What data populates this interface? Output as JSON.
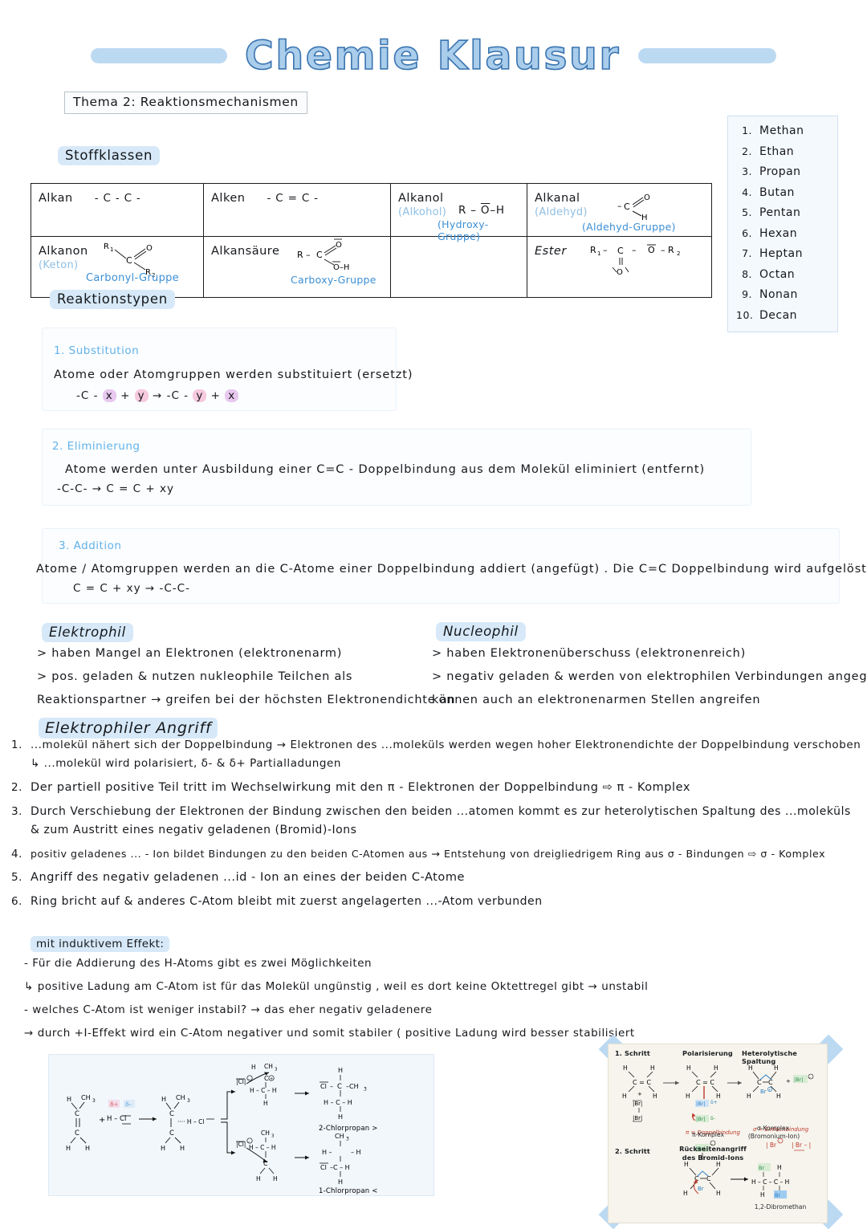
{
  "header": {
    "title": "Chemie Klausur",
    "topic": "Thema 2: Reaktionsmechanismen"
  },
  "sections": {
    "stoffklassen": "Stoffklassen",
    "reaktionstypen": "Reaktionstypen",
    "elektrophil": "Elektrophil",
    "nucleophil": "Nucleophil",
    "elektrophiler_angriff": "Elektrophiler Angriff",
    "induktiver_effekt": "mit induktivem Effekt:"
  },
  "stoffklassen_table": {
    "rows": [
      [
        {
          "name": "Alkan",
          "sub": "",
          "formula": "- C - C -",
          "group": ""
        },
        {
          "name": "Alken",
          "sub": "",
          "formula": "- C = C -",
          "group": ""
        },
        {
          "name": "Alkanol",
          "sub": "(Alkohol)",
          "formula": "R - O - H",
          "group": "(Hydroxy-Gruppe)"
        },
        {
          "name": "Alkanal",
          "sub": "(Aldehyd)",
          "formula": "- C O H",
          "group": "(Aldehyd-Gruppe)"
        }
      ],
      [
        {
          "name": "Alkanon",
          "sub": "(Keton)",
          "formula": "R1 C O R2",
          "group": "Carbonyl-Gruppe"
        },
        {
          "name": "Alkansäure",
          "sub": "",
          "formula": "R - C O O-H",
          "group": "Carboxy-Gruppe"
        },
        {
          "name": "",
          "sub": "",
          "formula": "",
          "group": ""
        },
        {
          "name": "Ester",
          "sub": "",
          "formula": "R1 - C - O - R2",
          "group": ""
        }
      ]
    ]
  },
  "alkane_list": {
    "items": [
      {
        "num": "1.",
        "name": "Methan"
      },
      {
        "num": "2.",
        "name": "Ethan"
      },
      {
        "num": "3.",
        "name": "Propan"
      },
      {
        "num": "4.",
        "name": "Butan"
      },
      {
        "num": "5.",
        "name": "Pentan"
      },
      {
        "num": "6.",
        "name": "Hexan"
      },
      {
        "num": "7.",
        "name": "Heptan"
      },
      {
        "num": "8.",
        "name": "Octan"
      },
      {
        "num": "9.",
        "name": "Nonan"
      },
      {
        "num": "10.",
        "name": "Decan"
      }
    ]
  },
  "reaktionstypen": {
    "substitution": {
      "label": "1. Substitution",
      "text": "Atome   oder   Atomgruppen   werden   substituiert  (ersetzt)",
      "eqn_pre": "-C -",
      "eqn_x": "x",
      "eqn_plus": "+",
      "eqn_y": "y",
      "eqn_arrow": "→",
      "eqn_post": "-C -",
      "eqn_y2": "y",
      "eqn_x2": "x"
    },
    "eliminierung": {
      "label": "2. Eliminierung",
      "text": "Atome   werden   unter   Ausbildung   einer   C=C - Doppelbindung   aus dem   Molekül   eliminiert (entfernt)",
      "eqn": "-C-C-   →   C = C  + xy"
    },
    "addition": {
      "label": "3. Addition",
      "text": "Atome / Atomgruppen   werden   an die   C-Atome   einer   Doppelbindung   addiert (angefügt) . Die   C=C   Doppelbindung   wird   aufgelöst",
      "eqn": "C = C + xy   →   -C-C-"
    }
  },
  "elektrophil_lines": [
    "> haben  Mangel   an   Elektronen   (elektronenarm)",
    "> pos.  geladen &  nutzen   nukleophile   Teilchen   als",
    "Reaktionspartner →  greifen  bei  der  höchsten   Elektronendichte  an"
  ],
  "nucleophil_lines": [
    "> haben   Elektronenüberschuss  (elektronenreich)",
    "> negativ  geladen &  werden   von  elektrophilen  Verbindungen  angegriffen /",
    "können  auch  an   elektronenarmen  Stellen  angreifen"
  ],
  "angriff_steps": [
    {
      "num": "1.",
      "lines": [
        "...molekül  nähert    sich    der   Doppelbindung → Elektronen  des  ...moleküls  werden   wegen hoher  Elektronendichte  der  Doppelbindung  verschoben",
        "↳ ...molekül  wird   polarisiert,  δ- & δ+  Partialladungen"
      ]
    },
    {
      "num": "2.",
      "lines": [
        "Der   partiell   positive   Teil   tritt   im   Wechselwirkung  mit   den  π - Elektronen   der   Doppelbindung ⇨  π - Komplex"
      ]
    },
    {
      "num": "3.",
      "lines": [
        "Durch  Verschiebung  der  Elektronen  der  Bindung  zwischen  den  beiden  ...atomen  kommt  es   zur heterolytischen Spaltung  des  ...moleküls",
        "& zum  Austritt   eines   negativ  geladenen   (Bromid)-Ions"
      ]
    },
    {
      "num": "4.",
      "lines": [
        "positiv  geladenes ... - Ion  bildet  Bindungen   zu den   beiden   C-Atomen   aus → Entstehung  von dreigliedrigem  Ring aus  σ - Bindungen ⇨ σ - Komplex"
      ]
    },
    {
      "num": "5.",
      "lines": [
        "Angriff  des  negativ  geladenen   ...id - Ion   an  eines  der   beiden  C-Atome"
      ]
    },
    {
      "num": "6.",
      "lines": [
        "Ring  bricht  auf &  anderes   C-Atom   bleibt  mit   zuerst angelagerten   ...-Atom   verbunden"
      ]
    }
  ],
  "induktiv_lines": [
    "-  Für  die  Addierung   des   H-Atoms  gibt   es  zwei   Möglichkeiten",
    "↳ positive  Ladung   am   C-Atom   ist  für   das Molekül   ungünstig , weil es   dort  keine   Oktettregel  gibt → unstabil",
    "- welches   C-Atom   ist  weniger   instabil? →  das  eher   negativ   geladenere",
    "→ durch   +I-Effekt    wird  ein   C-Atom  negativer  und  somit   stabiler  ( positive  Ladung  wird  besser   stabilisiert"
  ],
  "diagram_left": {
    "reactant_alkene": "H, CH3, C, C, H, H",
    "reagent": "H — Cl",
    "delta_pos": "δ+",
    "delta_neg": "δ-",
    "product_top_label": "2-Chlorpropan >",
    "product_bottom_label": "1-Chlorpropan <",
    "atoms": {
      "H": "H",
      "CH3": "CH3",
      "C": "C",
      "Cl": "Cl"
    }
  },
  "diagram_right": {
    "step1_label": "1. Schritt",
    "step2_label": "2. Schritt",
    "col_polarisierung": "Polarisierung",
    "col_spaltung": "Heterolytische Spaltung",
    "pi_komplex": "π-Komplex",
    "sigma_komplex": "σ-Komplex",
    "sigma_komplex_sub": "(Bromonium-Ion)",
    "rueckseitenangriff": "Rückseitenangriff",
    "rueckseitenangriff_sub": "des Bromid-Ions",
    "product": "1,2-Dibromethan",
    "note_pi": "π = Doppelbindung",
    "note_sigma": "σ = Einfachbindung",
    "atoms": {
      "H": "H",
      "C": "C",
      "Br": "Br"
    }
  },
  "colors": {
    "title_fill": "#a9cdeb",
    "title_stroke": "#3a74b0",
    "chip_bg": "#d7e9f8",
    "blue_ink": "#3c8fd4",
    "light_blue_ink": "#8fbfe4",
    "pink_highlight": "#f6c9de",
    "violet_highlight": "#e8c8ee",
    "panel_bg": "#fbfdff",
    "right_diagram_bg": "#f6f4ec",
    "left_diagram_bg": "#f2f7fc"
  }
}
